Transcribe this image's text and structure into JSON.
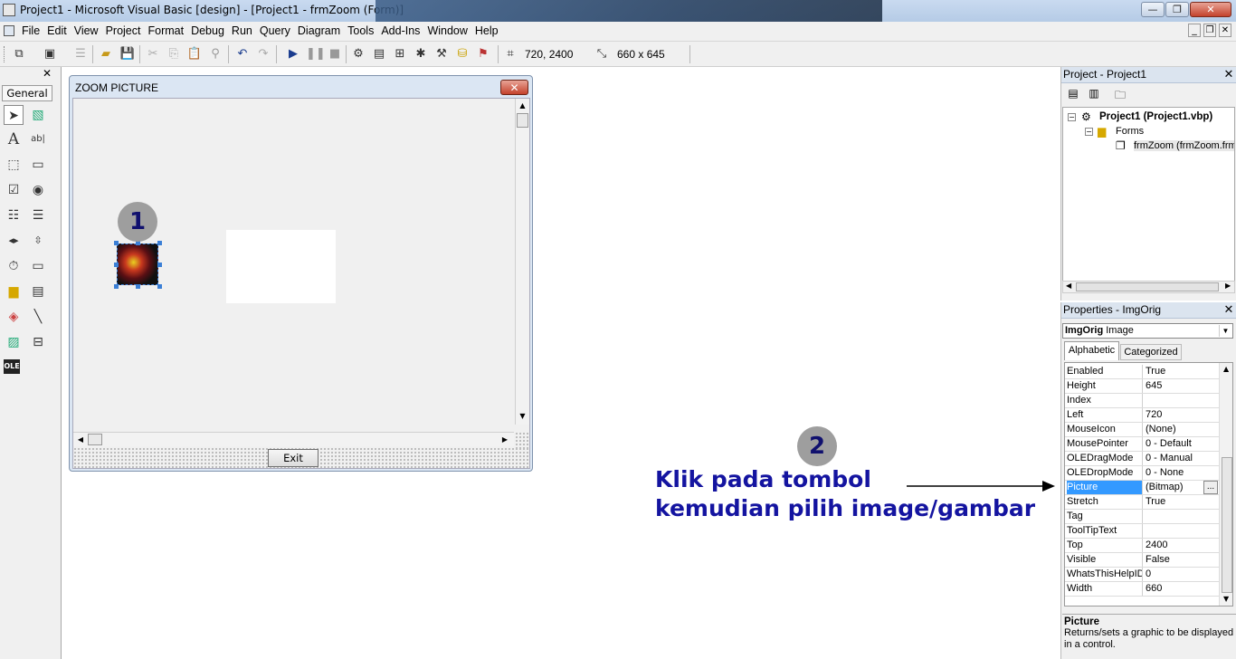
{
  "titlebar": {
    "title": "Project1 - Microsoft Visual Basic [design] - [Project1 - frmZoom (Form)]",
    "btn_min": "—",
    "btn_max": "❐",
    "btn_close": "✕"
  },
  "menubar": {
    "items": [
      "File",
      "Edit",
      "View",
      "Project",
      "Format",
      "Debug",
      "Run",
      "Query",
      "Diagram",
      "Tools",
      "Add-Ins",
      "Window",
      "Help"
    ],
    "mdi_min": "_",
    "mdi_restore": "❐",
    "mdi_close": "✕"
  },
  "toolbar": {
    "position": "720, 2400",
    "size": "660 x 645"
  },
  "toolbox": {
    "tab_label": "General",
    "close_label": "✕"
  },
  "form": {
    "title": "ZOOM PICTURE",
    "close_label": "✕",
    "exit_label": "Exit"
  },
  "callouts": {
    "step1": "1",
    "step2": "2",
    "instruction_line1": "Klik pada tombol",
    "instruction_line2": "kemudian pilih image/gambar"
  },
  "project_panel": {
    "title": "Project - Project1",
    "close_label": "✕",
    "tree": {
      "project": "Project1 (Project1.vbp)",
      "folder": "Forms",
      "form": "frmZoom (frmZoom.frm)"
    }
  },
  "properties_panel": {
    "title": "Properties - ImgOrig",
    "close_label": "✕",
    "object_name": "ImgOrig",
    "object_type": "Image",
    "tabs": [
      "Alphabetic",
      "Categorized"
    ],
    "rows": [
      {
        "name": "Enabled",
        "value": "True"
      },
      {
        "name": "Height",
        "value": "645"
      },
      {
        "name": "Index",
        "value": ""
      },
      {
        "name": "Left",
        "value": "720"
      },
      {
        "name": "MouseIcon",
        "value": "(None)"
      },
      {
        "name": "MousePointer",
        "value": "0 - Default"
      },
      {
        "name": "OLEDragMode",
        "value": "0 - Manual"
      },
      {
        "name": "OLEDropMode",
        "value": "0 - None"
      },
      {
        "name": "Picture",
        "value": "(Bitmap)"
      },
      {
        "name": "Stretch",
        "value": "True"
      },
      {
        "name": "Tag",
        "value": ""
      },
      {
        "name": "ToolTipText",
        "value": ""
      },
      {
        "name": "Top",
        "value": "2400"
      },
      {
        "name": "Visible",
        "value": "False"
      },
      {
        "name": "WhatsThisHelpID",
        "value": "0"
      },
      {
        "name": "Width",
        "value": "660"
      }
    ],
    "ellipsis": "...",
    "desc_title": "Picture",
    "desc_text": "Returns/sets a graphic to be displayed in a control."
  },
  "colors": {
    "callout_text": "#1414a0",
    "selection": "#3399ff"
  }
}
